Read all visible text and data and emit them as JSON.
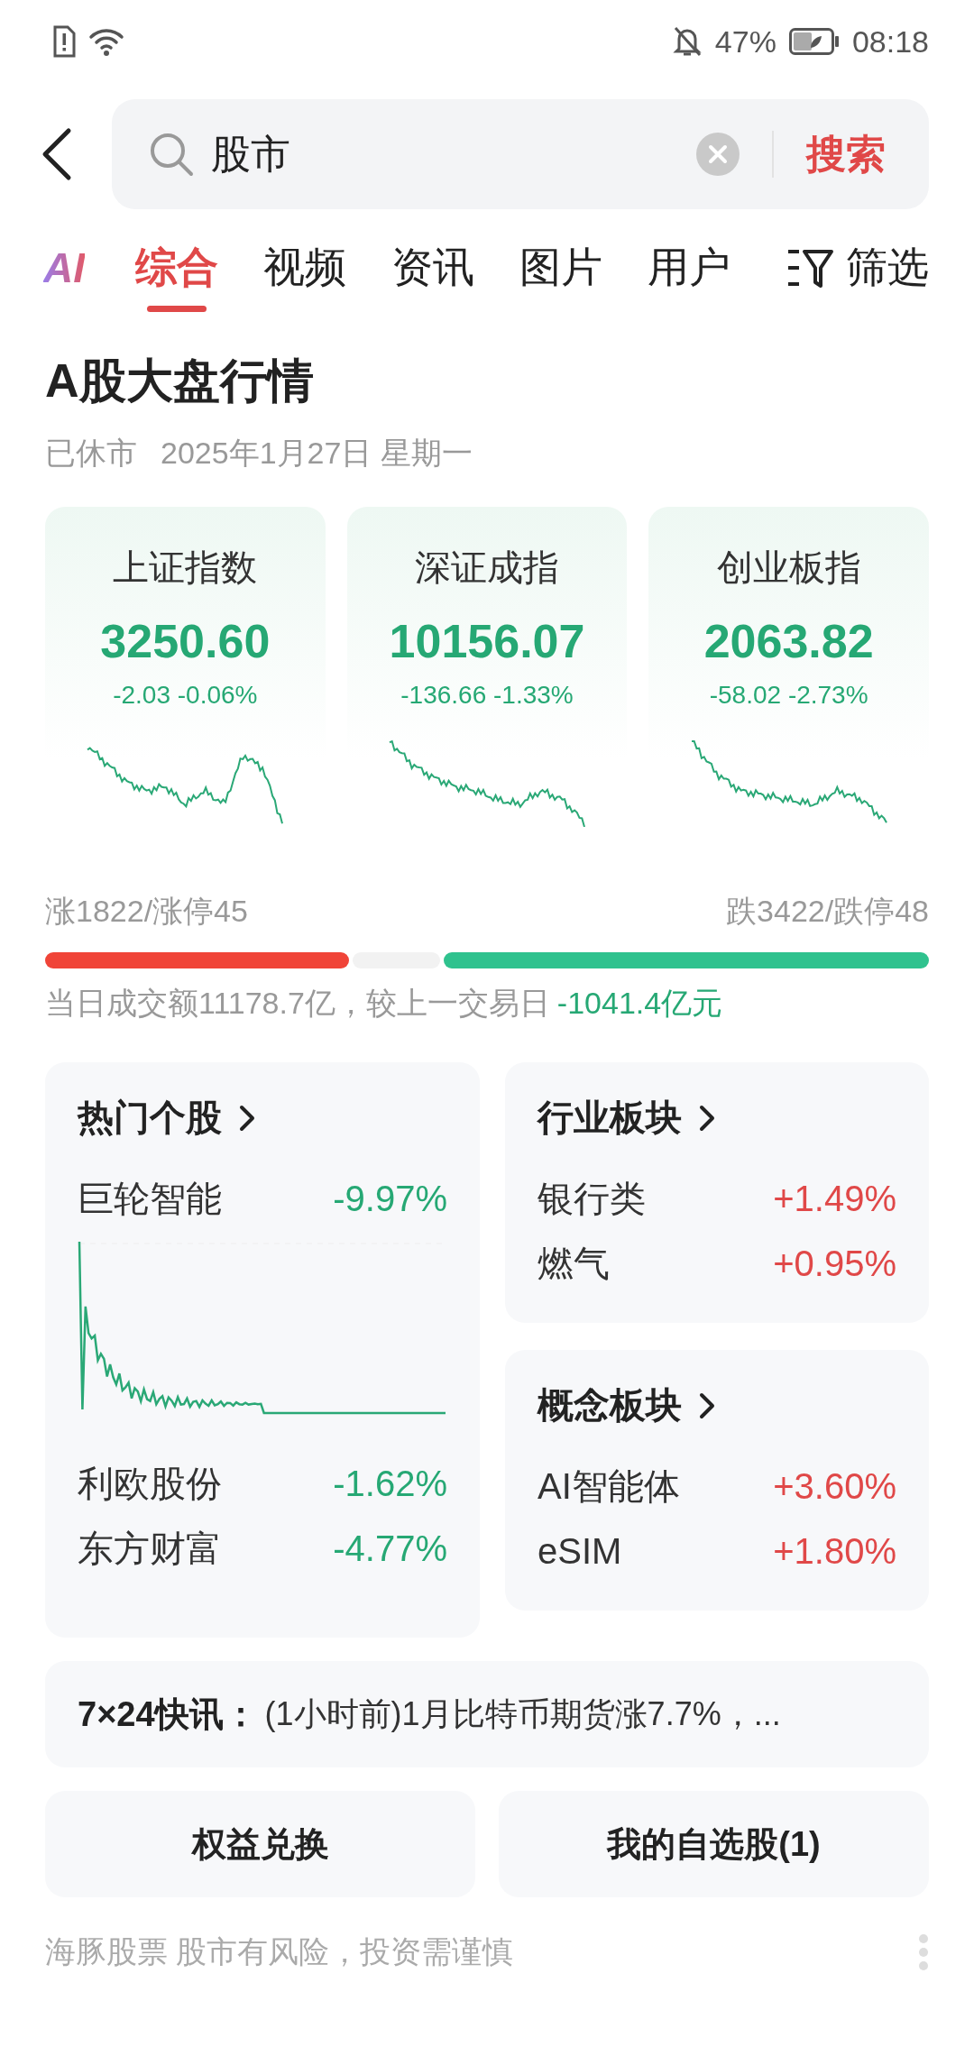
{
  "status_bar": {
    "battery": "47%",
    "time": "08:18"
  },
  "search": {
    "value": "股市",
    "submit": "搜索"
  },
  "tabs": [
    {
      "label": "AI",
      "kind": "ai",
      "selected": false
    },
    {
      "label": "综合",
      "kind": "text",
      "selected": true
    },
    {
      "label": "视频",
      "kind": "text",
      "selected": false
    },
    {
      "label": "资讯",
      "kind": "text",
      "selected": false
    },
    {
      "label": "图片",
      "kind": "text",
      "selected": false
    },
    {
      "label": "用户",
      "kind": "text",
      "selected": false
    }
  ],
  "filter": {
    "label": "筛选"
  },
  "market": {
    "title": "A股大盘行情",
    "status": "已休市",
    "date": "2025年1月27日 星期一",
    "indices": [
      {
        "name": "上证指数",
        "value": "3250.60",
        "change": "-2.03 -0.06%",
        "kind": "down"
      },
      {
        "name": "深证成指",
        "value": "10156.07",
        "change": "-136.66 -1.33%",
        "kind": "down"
      },
      {
        "name": "创业板指",
        "value": "2063.82",
        "change": "-58.02 -2.73%",
        "kind": "down"
      }
    ],
    "rise_count": "涨1822/涨停45",
    "fall_count": "跌3422/跌停48",
    "turnover": {
      "text": "当日成交额11178.7亿，较上一交易日",
      "change": "-1041.4亿元",
      "kind": "down"
    }
  },
  "hot_stocks": {
    "title": "热门个股",
    "items": [
      {
        "name": "巨轮智能",
        "change": "-9.97%",
        "kind": "down"
      },
      {
        "name": "利欧股份",
        "change": "-1.62%",
        "kind": "down"
      },
      {
        "name": "东方财富",
        "change": "-4.77%",
        "kind": "down"
      }
    ]
  },
  "sectors": [
    {
      "title": "行业板块",
      "items": [
        {
          "name": "银行类",
          "change": "+1.49%",
          "kind": "up"
        },
        {
          "name": "燃气",
          "change": "+0.95%",
          "kind": "up"
        }
      ]
    },
    {
      "title": "概念板块",
      "items": [
        {
          "name": "AI智能体",
          "change": "+3.60%",
          "kind": "up"
        },
        {
          "name": "eSIM",
          "change": "+1.80%",
          "kind": "up"
        }
      ]
    }
  ],
  "news": {
    "label": "7×24快讯：",
    "text": "(1小时前)1月比特币期货涨7.7%，..."
  },
  "buttons": [
    "权益兑换",
    "我的自选股(1)"
  ],
  "footer": "海豚股票 股市有风险，投资需谨慎"
}
